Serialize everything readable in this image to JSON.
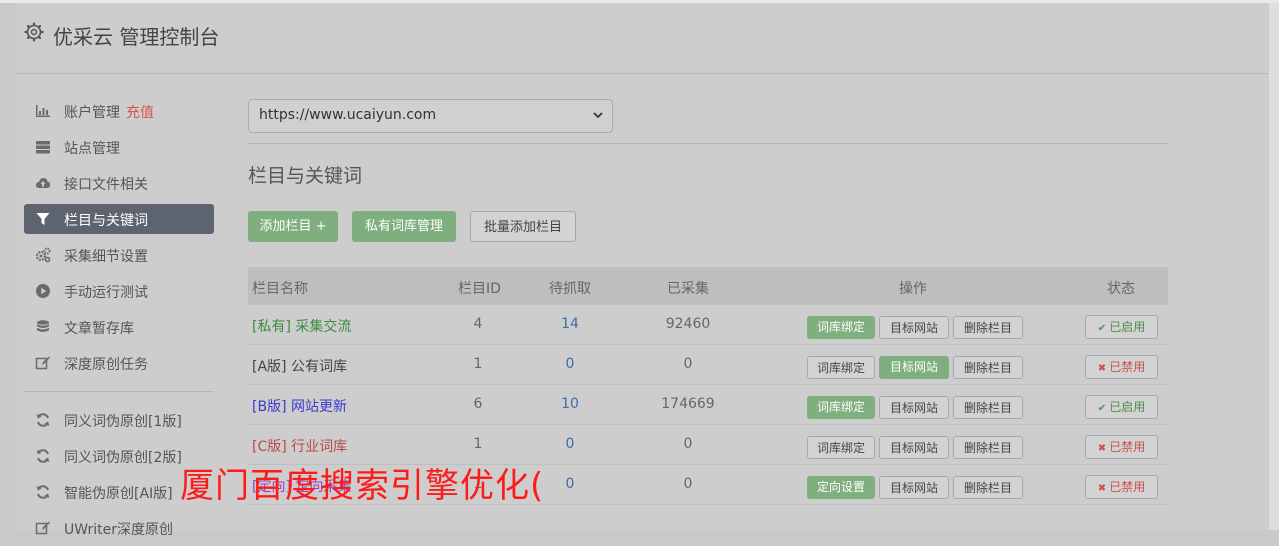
{
  "app": {
    "title": "优采云 管理控制台"
  },
  "sidebar": {
    "items": [
      {
        "label": "账户管理",
        "extra": "充值",
        "icon": "bar-chart-icon"
      },
      {
        "label": "站点管理",
        "icon": "server-icon"
      },
      {
        "label": "接口文件相关",
        "icon": "cloud-upload-icon"
      },
      {
        "label": "栏目与关键词",
        "icon": "filter-icon",
        "active": true
      },
      {
        "label": "采集细节设置",
        "icon": "cogs-icon"
      },
      {
        "label": "手动运行测试",
        "icon": "play-circle-icon"
      },
      {
        "label": "文章暂存库",
        "icon": "database-icon"
      },
      {
        "label": "深度原创任务",
        "icon": "edit-icon"
      }
    ],
    "items2": [
      {
        "label": "同义词伪原创[1版]",
        "icon": "refresh-icon"
      },
      {
        "label": "同义词伪原创[2版]",
        "icon": "refresh-icon"
      },
      {
        "label": "智能伪原创[AI版]",
        "icon": "refresh-icon"
      },
      {
        "label": "UWriter深度原创",
        "icon": "edit-icon"
      }
    ]
  },
  "main": {
    "site_select": {
      "value": "https://www.ucaiyun.com"
    },
    "heading": "栏目与关键词",
    "buttons": {
      "add": "添加栏目 +",
      "private": "私有词库管理",
      "batch": "批量添加栏目"
    }
  },
  "table": {
    "headers": {
      "name": "栏目名称",
      "id": "栏目ID",
      "pending": "待抓取",
      "collected": "已采集",
      "ops": "操作",
      "status": "状态"
    },
    "rows": [
      {
        "name": "[私有] 采集交流",
        "name_color": "#3d8b3d",
        "id": "4",
        "pending": "14",
        "collected": "92460",
        "op1": "词库绑定",
        "op1_active": true,
        "op2": "目标网站",
        "op2_active": false,
        "op3": "删除栏目",
        "status": "已启用",
        "status_on": true,
        "status_icon": "✔"
      },
      {
        "name": "[A版] 公有词库",
        "name_color": "#444444",
        "id": "1",
        "pending": "0",
        "collected": "0",
        "op1": "词库绑定",
        "op1_active": false,
        "op2": "目标网站",
        "op2_active": true,
        "op3": "删除栏目",
        "status": "已禁用",
        "status_on": false,
        "status_icon": "✖"
      },
      {
        "name": "[B版] 网站更新",
        "name_color": "#3b3bd0",
        "id": "6",
        "pending": "10",
        "collected": "174669",
        "op1": "词库绑定",
        "op1_active": true,
        "op2": "目标网站",
        "op2_active": false,
        "op3": "删除栏目",
        "status": "已启用",
        "status_on": true,
        "status_icon": "✔"
      },
      {
        "name": "[C版] 行业词库",
        "name_color": "#b94a48",
        "id": "1",
        "pending": "0",
        "collected": "0",
        "op1": "词库绑定",
        "op1_active": false,
        "op2": "目标网站",
        "op2_active": false,
        "op3": "删除栏目",
        "status": "已禁用",
        "status_on": false,
        "status_icon": "✖"
      },
      {
        "name": "[定向] 定向采集",
        "name_color": "#a040c0",
        "id": "1",
        "pending": "0",
        "collected": "0",
        "op1": "定向设置",
        "op1_active": true,
        "op2": "目标网站",
        "op2_active": false,
        "op3": "删除栏目",
        "status": "已禁用",
        "status_on": false,
        "status_icon": "✖"
      }
    ]
  },
  "overlay": {
    "text": "厦门百度搜索引擎优化("
  }
}
